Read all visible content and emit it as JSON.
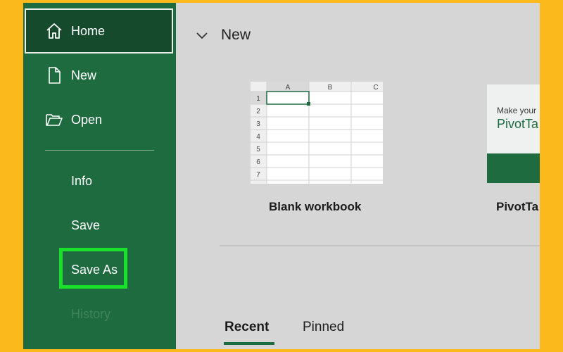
{
  "sidebar": {
    "items": [
      {
        "label": "Home",
        "icon": "home-icon"
      },
      {
        "label": "New",
        "icon": "document-icon"
      },
      {
        "label": "Open",
        "icon": "folder-open-icon"
      },
      {
        "label": "Info"
      },
      {
        "label": "Save"
      },
      {
        "label": "Save As"
      },
      {
        "label": "History"
      }
    ],
    "highlight_color": "#18e02b"
  },
  "main": {
    "section_title": "New",
    "templates": [
      {
        "label": "Blank workbook",
        "columns": [
          "A",
          "B",
          "C"
        ],
        "rows": [
          "1",
          "2",
          "3",
          "4",
          "5",
          "6",
          "7"
        ]
      },
      {
        "label": "PivotTa",
        "line1": "Make your",
        "line2": "PivotTa"
      }
    ],
    "tabs": [
      {
        "label": "Recent",
        "active": true
      },
      {
        "label": "Pinned",
        "active": false
      }
    ]
  },
  "colors": {
    "sidebar_bg": "#1e6b40",
    "frame_bg": "#fbb91c",
    "main_bg": "#d6d6d6"
  }
}
